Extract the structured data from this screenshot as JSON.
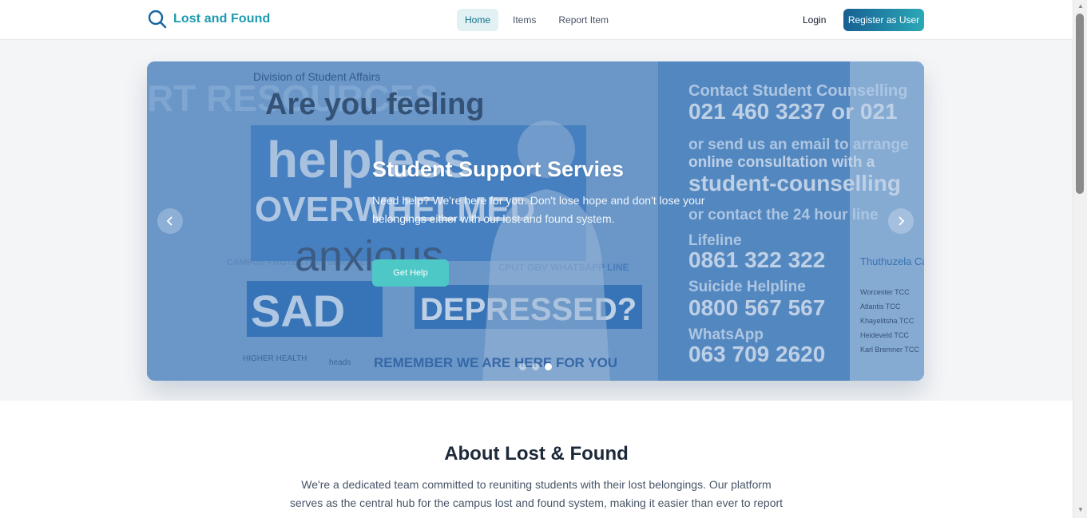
{
  "brand": {
    "name": "Lost and Found",
    "icon": "search-icon",
    "color": "#1c9bb0"
  },
  "nav": {
    "links": [
      {
        "label": "Home",
        "active": true
      },
      {
        "label": "Items",
        "active": false
      },
      {
        "label": "Report Item",
        "active": false
      }
    ],
    "login_label": "Login",
    "register_label": "Register as User"
  },
  "carousel": {
    "slide": {
      "title": "Student Support Servies",
      "description": "Need help? We're here for you. Don't lose hope and don't lose your belongings either with our lost and found system.",
      "button_label": "Get Help"
    },
    "slide_count": 3,
    "active_index": 2,
    "poster_lines": {
      "header": "Division of Student Affairs",
      "headline": "Are you feeling",
      "words": [
        "helpless",
        "OVERWHELMED",
        "anxious",
        "SAD",
        "DEPRESSED?"
      ],
      "whatsapp": "CPUT GBV WHATSAPP LINE",
      "footer": "REMEMBER WE ARE HERE FOR YOU",
      "contact_heading": "Contact Student Counselling",
      "phone_main": "021 460 3237 or 021",
      "email_line": "or send us an email to arrange",
      "online": "online consultation with a",
      "email": "student-counselling",
      "hotline": "or contact the 24 hour line",
      "lifeline_label": "Lifeline",
      "lifeline_number": "0861 322 322",
      "suicide_label": "Suicide Helpline",
      "suicide_number": "0800 567 567",
      "whatsapp_label": "WhatsApp",
      "whatsapp_number": "063 709 2620",
      "side_heading": "Thuthuzela Care Centre",
      "side_items": [
        "Worcester TCC",
        "Atlantis TCC",
        "Khayelitsha TCC",
        "Heideveld TCC",
        "Karl Bremner TCC"
      ],
      "left_heading": "RT RESOURCES",
      "left_section": "CAMPUS PROTECTION SERVICES",
      "logo_1": "HIGHER HEALTH",
      "logo_2": "heads"
    }
  },
  "about": {
    "title": "About Lost & Found",
    "text": "We're a dedicated team committed to reuniting students with their lost belongings. Our platform serves as the central hub for the campus lost and found system, making it easier than ever to report"
  }
}
